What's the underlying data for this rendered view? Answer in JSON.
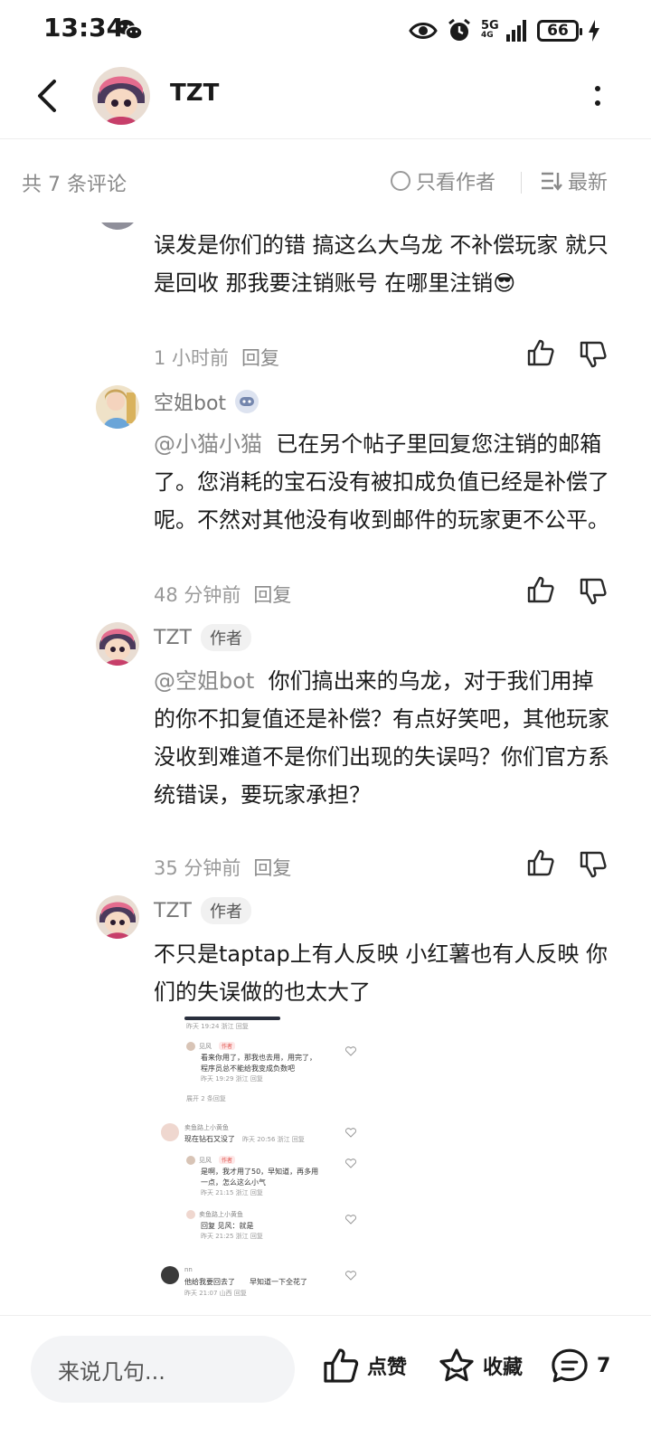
{
  "status_bar": {
    "time": "13:34",
    "network": "5G",
    "network_sub": "4G",
    "battery": "66",
    "icons": [
      "wechat-icon",
      "eye-icon",
      "alarm-icon",
      "signal-icon",
      "battery-icon",
      "charging-icon"
    ]
  },
  "header": {
    "title": "TZT"
  },
  "sort_bar": {
    "count": "共 7 条评论",
    "only_author": "只看作者",
    "sort": "最新"
  },
  "comments": [
    {
      "text": "误发是你们的错 搞这么大乌龙 不补偿玩家 就只是回收 那我要注销账号 在哪里注销😎",
      "time": "1 小时前",
      "reply": "回复"
    },
    {
      "name": "空姐bot",
      "mention": "@小猫小猫",
      "text": "已在另个帖子里回复您注销的邮箱了。您消耗的宝石没有被扣成负值已经是补偿了呢。不然对其他没有收到邮件的玩家更不公平。",
      "time": "48 分钟前",
      "reply": "回复"
    },
    {
      "name": "TZT",
      "tag": "作者",
      "mention": "@空姐bot",
      "text": "你们搞出来的乌龙，对于我们用掉的你不扣复值还是补偿？有点好笑吧，其他玩家没收到难道不是你们出现的失误吗？你们官方系统错误，要玩家承担？",
      "time": "35 分钟前",
      "reply": "回复"
    },
    {
      "name": "TZT",
      "tag": "作者",
      "text": "不只是taptap上有人反映 小红薯也有人反映 你们的失误做的也太大了"
    }
  ],
  "embed": {
    "lines": [
      "昨天 19:24 浙江  回复",
      "见风",
      "作者",
      "看来你用了，那我也去用，用完了，",
      "程序员总不能给我变成负数吧",
      "昨天 19:29 浙江  回复",
      "展开 2 条回复",
      "卖鱼路上小黄鱼",
      "现在钻石又没了",
      "昨天 20:56 浙江  回复",
      "见风",
      "作者",
      "是啊，我才用了50，早知道，再多用",
      "一点，怎么这么小气",
      "昨天 21:15 浙江  回复",
      "卖鱼路上小黄鱼",
      "回复  见风：就是",
      "昨天 21:25 浙江  回复",
      "nn",
      "他给我要回去了",
      "早知道一下全花了",
      "昨天 21:07 山西  回复"
    ]
  },
  "bottom_bar": {
    "placeholder": "来说几句...",
    "like": "点赞",
    "favorite": "收藏",
    "comment_count": "7"
  }
}
